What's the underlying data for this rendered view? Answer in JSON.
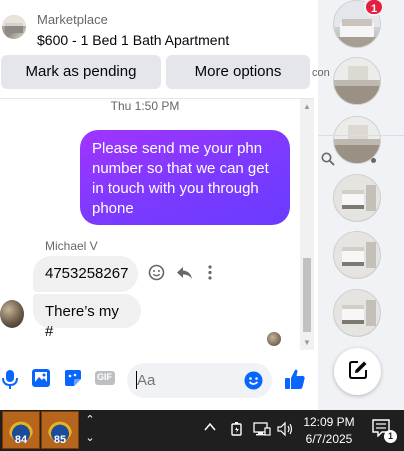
{
  "listing": {
    "source": "Marketplace",
    "title": "$600 - 1 Bed 1 Bath Apartment",
    "thumbnail_icon": "listing-thumbnail"
  },
  "actions": {
    "mark_pending": "Mark as pending",
    "more_options": "More options"
  },
  "conversation": {
    "timestamp": "Thu 1:50 PM",
    "outgoing": [
      {
        "text": "Please send me your phn number so that we can get in touch with you through phone"
      }
    ],
    "incoming_sender": "Michael V",
    "incoming": [
      {
        "text": "4753258267"
      },
      {
        "text": "There’s my #"
      }
    ],
    "message_actions": [
      "smiley-react-icon",
      "reply-icon",
      "more-vertical-icon"
    ]
  },
  "composer": {
    "placeholder": "Aa",
    "icons": [
      "microphone-icon",
      "photo-icon",
      "sticker-icon",
      "gif-icon",
      "emoji-icon",
      "like-thumb-icon"
    ],
    "gif_label": "GIF"
  },
  "rail": {
    "unread_badge": "1",
    "partial_text": "con",
    "chats": [
      "room-a",
      "room-b",
      "room-b",
      "room-c",
      "room-c",
      "room-c"
    ]
  },
  "taskbar": {
    "apps": [
      {
        "label": "84"
      },
      {
        "label": "85"
      }
    ],
    "time": "12:09 PM",
    "date": "6/7/2025",
    "notification_count": "1"
  },
  "colors": {
    "messenger_purple": "#7c3aff",
    "accent_blue": "#0866ff",
    "badge_red": "#e41e3f",
    "bubble_gray": "#f0f0f0",
    "taskbar": "#1f1f1f"
  }
}
